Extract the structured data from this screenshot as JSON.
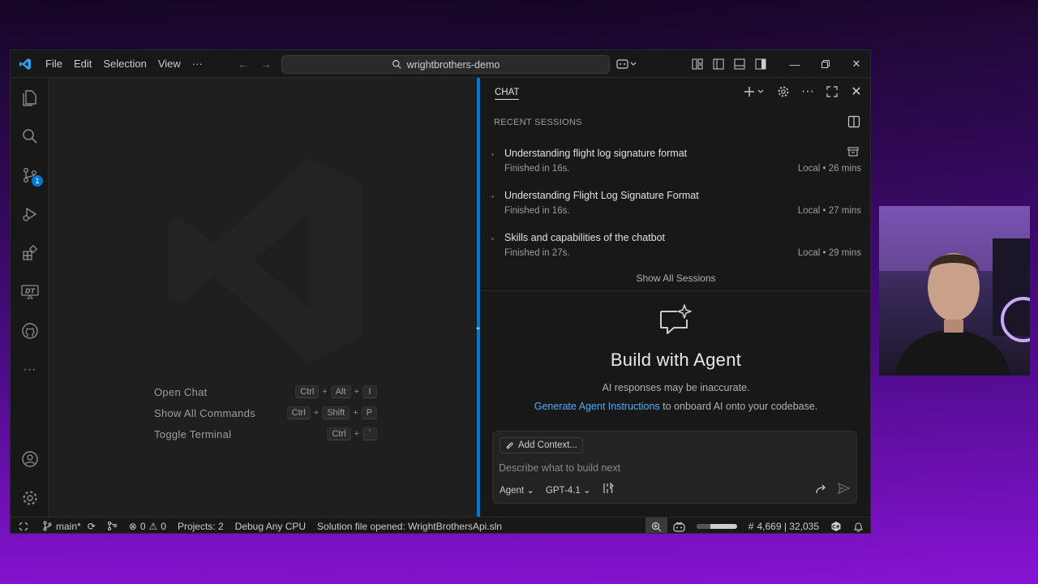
{
  "window": {
    "menu": [
      "File",
      "Edit",
      "Selection",
      "View",
      "···"
    ],
    "search_text": "wrightbrothers-demo"
  },
  "activity_bar": {
    "items": [
      "explorer",
      "search",
      "source-control",
      "run-and-debug",
      "extensions",
      "dotnet-test",
      "github",
      "more"
    ],
    "source_control_badge": "1"
  },
  "editor": {
    "shortcuts": [
      {
        "label": "Open Chat",
        "keys": [
          "Ctrl",
          "Alt",
          "I"
        ]
      },
      {
        "label": "Show All Commands",
        "keys": [
          "Ctrl",
          "Shift",
          "P"
        ]
      },
      {
        "label": "Toggle Terminal",
        "keys": [
          "Ctrl",
          "`"
        ]
      }
    ]
  },
  "chat": {
    "title": "CHAT",
    "recent_header": "RECENT SESSIONS",
    "sessions": [
      {
        "title": "Understanding flight log signature format",
        "subtitle": "Finished in 16s.",
        "meta": "Local • 26 mins"
      },
      {
        "title": "Understanding Flight Log Signature Format",
        "subtitle": "Finished in 16s.",
        "meta": "Local • 27 mins"
      },
      {
        "title": "Skills and capabilities of the chatbot",
        "subtitle": "Finished in 27s.",
        "meta": "Local • 29 mins"
      }
    ],
    "show_all": "Show All Sessions",
    "agent_title": "Build with Agent",
    "agent_warning": "AI responses may be inaccurate.",
    "instructions_link": "Generate Agent Instructions",
    "instructions_rest": " to onboard AI onto your codebase.",
    "add_context": "Add Context...",
    "input_placeholder": "Describe what to build next",
    "mode": "Agent",
    "model": "GPT-4.1"
  },
  "statusbar": {
    "branch": "main*",
    "errors": "0",
    "warnings": "0",
    "projects": "Projects: 2",
    "config": "Debug Any CPU",
    "solution": "Solution file opened: WrightBrothersApi.sln",
    "progress_fraction": 0.35,
    "counts": "4,669 | 32,035"
  },
  "colors": {
    "accent": "#0078d4",
    "link": "#4daafc",
    "background": "#1f1f1f",
    "panel": "#181818"
  }
}
